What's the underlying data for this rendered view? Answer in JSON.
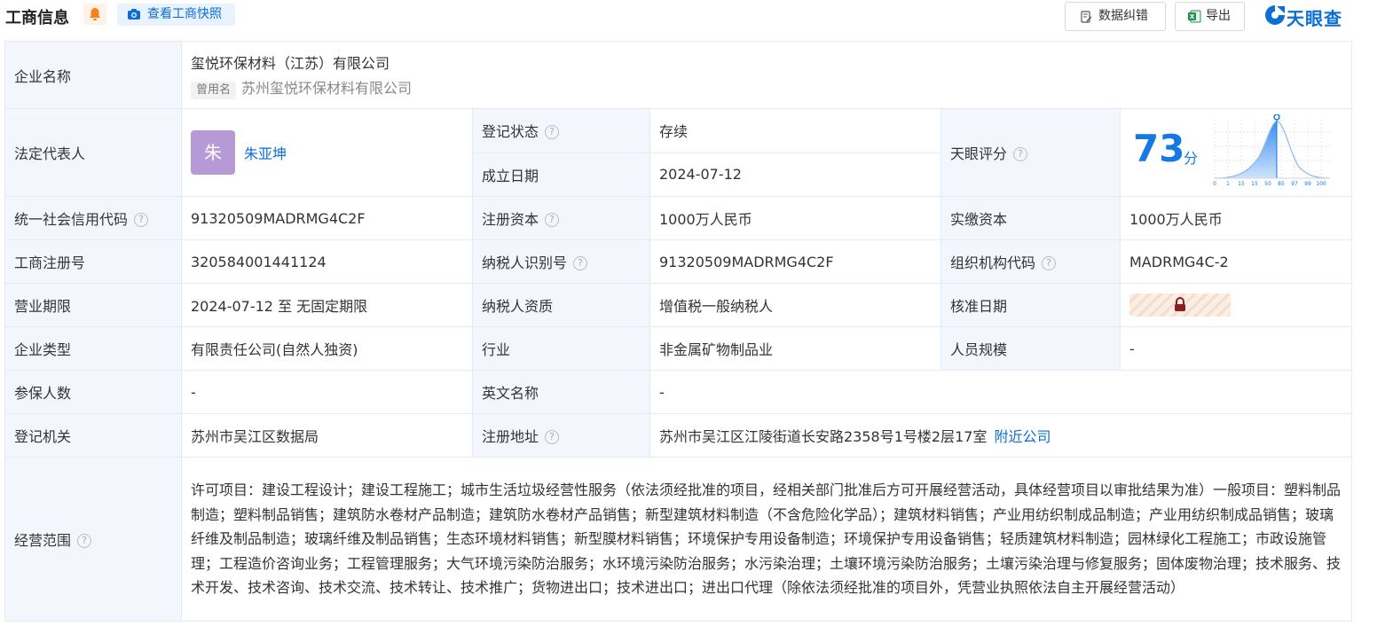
{
  "header": {
    "title": "工商信息",
    "snapshot_label": "查看工商快照",
    "correct_label": "数据纠错",
    "export_label": "导出",
    "logo_text": "天眼查",
    "accent_color": "#0a6ed1"
  },
  "company": {
    "name_label": "企业名称",
    "name": "玺悦环保材料（江苏）有限公司",
    "former_tag": "曾用名",
    "former_name": "苏州玺悦环保材料有限公司",
    "legal_rep_label": "法定代表人",
    "legal_rep_avatar": "朱",
    "legal_rep": "朱亚坤",
    "status_label": "登记状态",
    "status": "存续",
    "found_date_label": "成立日期",
    "found_date": "2024-07-12",
    "score_label": "天眼评分",
    "score": "73",
    "score_unit": "分",
    "score_ticks": [
      "0",
      "1",
      "15",
      "15",
      "50",
      "85",
      "97",
      "99",
      "100"
    ],
    "credit_code_label": "统一社会信用代码",
    "credit_code": "91320509MADRMG4C2F",
    "reg_capital_label": "注册资本",
    "reg_capital": "1000万人民币",
    "paid_capital_label": "实缴资本",
    "paid_capital": "1000万人民币",
    "reg_no_label": "工商注册号",
    "reg_no": "320584001441124",
    "taxpayer_id_label": "纳税人识别号",
    "taxpayer_id": "91320509MADRMG4C2F",
    "org_code_label": "组织机构代码",
    "org_code": "MADRMG4C-2",
    "term_label": "营业期限",
    "term": "2024-07-12 至 无固定期限",
    "taxpayer_qual_label": "纳税人资质",
    "taxpayer_qual": "增值税一般纳税人",
    "approve_date_label": "核准日期",
    "type_label": "企业类型",
    "type": "有限责任公司(自然人独资)",
    "industry_label": "行业",
    "industry": "非金属矿物制品业",
    "staff_size_label": "人员规模",
    "staff_size": "-",
    "insured_label": "参保人数",
    "insured": "-",
    "english_name_label": "英文名称",
    "english_name": "-",
    "authority_label": "登记机关",
    "authority": "苏州市吴江区数据局",
    "address_label": "注册地址",
    "address": "苏州市吴江区江陵街道长安路2358号1号楼2层17室",
    "nearby_link": "附近公司",
    "scope_label": "经营范围",
    "scope": "许可项目：建设工程设计；建设工程施工；城市生活垃圾经营性服务（依法须经批准的项目，经相关部门批准后方可开展经营活动，具体经营项目以审批结果为准）一般项目：塑料制品制造；塑料制品销售；建筑防水卷材产品制造；建筑防水卷材产品销售；新型建筑材料制造（不含危险化学品）；建筑材料销售；产业用纺织制成品制造；产业用纺织制成品销售；玻璃纤维及制品制造；玻璃纤维及制品销售；生态环境材料销售；新型膜材料销售；环境保护专用设备制造；环境保护专用设备销售；轻质建筑材料制造；园林绿化工程施工；市政设施管理；工程造价咨询业务；工程管理服务；大气环境污染防治服务；水环境污染防治服务；水污染治理；土壤环境污染防治服务；土壤污染治理与修复服务；固体废物治理；技术服务、技术开发、技术咨询、技术交流、技术转让、技术推广；货物进出口；技术进出口；进出口代理（除依法须经批准的项目外，凭营业执照依法自主开展经营活动）"
  }
}
